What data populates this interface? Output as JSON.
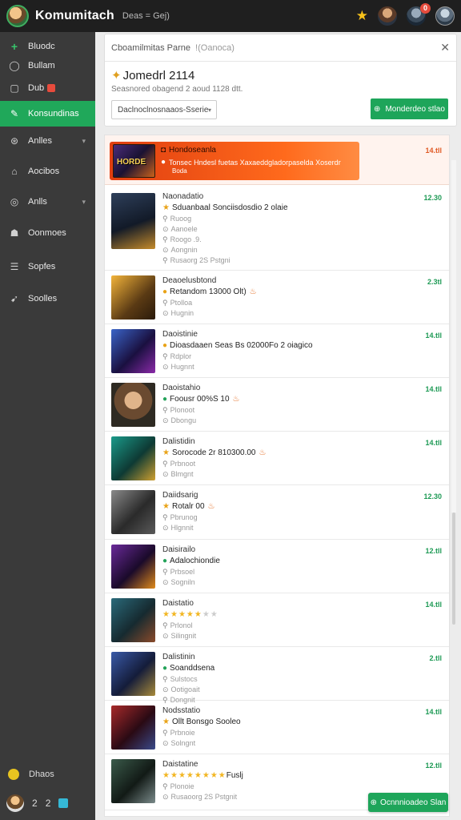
{
  "topbar": {
    "title": "Komumitach",
    "subtitle": "Deas = Gej)",
    "badge_count": "0"
  },
  "sidebar": {
    "items": [
      {
        "label": "Bluodc",
        "icon": "plus-icon",
        "glyph": "+"
      },
      {
        "label": "Bullam",
        "icon": "circle-icon",
        "glyph": "◯"
      },
      {
        "label": "Dub",
        "icon": "calendar-icon",
        "glyph": "▢"
      },
      {
        "label": "Konsundinas",
        "icon": "edit-icon",
        "glyph": "✎"
      },
      {
        "label": "Anlles",
        "icon": "globe-icon",
        "glyph": "⊛"
      },
      {
        "label": "Aocibos",
        "icon": "home-icon",
        "glyph": "⌂"
      },
      {
        "label": "Anlls",
        "icon": "clock-icon",
        "glyph": "◎"
      },
      {
        "label": "Oonmoes",
        "icon": "people-icon",
        "glyph": "☗"
      },
      {
        "label": "Sopfes",
        "icon": "list-icon",
        "glyph": "☰"
      },
      {
        "label": "Soolles",
        "icon": "megaphone-icon",
        "glyph": "➹"
      }
    ],
    "bottom_user": "Dhaos",
    "footer": {
      "count_a": "2",
      "count_b": "2"
    }
  },
  "header": {
    "breadcrumb": "Cboamilmitas Parne",
    "breadcrumb_muted": "!(Oanoca)",
    "title": "Jomedrl 2114",
    "subtitle": "Seasnored obagend 2 aoud 1128 dtt.",
    "filter_value": "Daclnoclnosnaaos-Sserie",
    "primary_button": "Monderdeo stlao"
  },
  "featured": {
    "line1": "Hondoseanla",
    "line2": "Tonsec Hndesl fuetas Xaxaeddgladorpaselda Xoserdr",
    "line3": "Boda",
    "time": "14.tll"
  },
  "rows": [
    {
      "name": "Naonadatio",
      "line": "Sduanbaal Sonciisdosdio 2 olaie",
      "meta1": "Ruoog",
      "meta2": "Aanoele",
      "meta3": "Roogo .9.",
      "meta4": "Aongnin",
      "meta5": "Rusaorg 2S Pstgni",
      "time": "12.30",
      "icon": "star-icon",
      "thumb": "t1"
    },
    {
      "name": "Deaoelusbtond",
      "line": "Retandom 13000 Olt)",
      "meta1": "Ptolloa",
      "meta2": "Hugnin",
      "time": "2.3tl",
      "icon": "",
      "thumb": "t2"
    },
    {
      "name": "Daoistinie",
      "line": "Dioasdaaen Seas Bs 02000Fo 2 oiagico",
      "meta1": "Rdplor",
      "meta2": "Hugnnt",
      "time": "14.tll",
      "icon": "",
      "thumb": "t3"
    },
    {
      "name": "Daoistahio",
      "line": "Foousr 00%S 10",
      "meta1": "Plonoot",
      "meta2": "Dbongu",
      "time": "14.tll",
      "icon": "check-icon",
      "thumb": "t4"
    },
    {
      "name": "Dalistidin",
      "line": "Sorocode 2r 810300.00",
      "meta1": "Prbnoot",
      "meta2": "Blmgnt",
      "time": "14.tll",
      "icon": "star-icon",
      "thumb": "t5"
    },
    {
      "name": "Daiidsarig",
      "line": "Rotalr 00",
      "meta1": "Pbrunog",
      "meta2": "Hlgnnit",
      "time": "12.30",
      "icon": "star-icon",
      "thumb": "t6"
    },
    {
      "name": "Daisirailo",
      "line": "Adalochiondie",
      "meta1": "Prbsoel",
      "meta2": "Sogniln",
      "time": "12.tll",
      "icon": "check-icon",
      "thumb": "t7"
    },
    {
      "name": "Daistatio",
      "line": "",
      "stars": 5,
      "stars_total": 7,
      "meta1": "Prlonol",
      "meta2": "Silingnit",
      "time": "14.tll",
      "icon": "",
      "thumb": "t8"
    },
    {
      "name": "Dalistinin",
      "line": "Soanddsena",
      "meta1": "Sulstocs",
      "meta2": "Ootigoait",
      "meta3": "Dongnit",
      "time": "2.tll",
      "icon": "check-icon",
      "thumb": "t9"
    },
    {
      "name": "Nodsstatio",
      "line": "Ollt Bonsgo Sooleo",
      "meta1": "Prbnoie",
      "meta2": "Solngnt",
      "time": "14.tll",
      "icon": "star-icon",
      "thumb": "t10"
    },
    {
      "name": "Daistatine",
      "line": "Fuslj",
      "stars": 8,
      "stars_total": 8,
      "meta1": "Plonoie",
      "meta2": "Rusaoorg 2S Pstgnit",
      "time": "12.tll",
      "icon": "",
      "thumb": "t11"
    }
  ],
  "fab": {
    "label": "Ocnnnioadeo Slan"
  },
  "colors": {
    "accent": "#1ea55a",
    "sidebar": "#3a3a3a",
    "topbar": "#1f1f1f",
    "featured": "#ff6a1c"
  }
}
